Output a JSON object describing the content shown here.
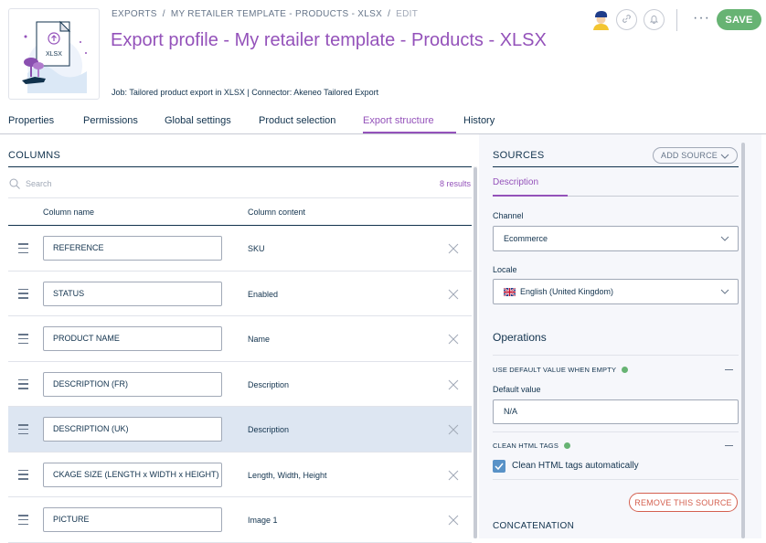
{
  "breadcrumb": {
    "items": [
      "EXPORTS",
      "MY RETAILER TEMPLATE - PRODUCTS - XLSX",
      "EDIT"
    ],
    "separator": "/"
  },
  "thumbnail": {
    "file_label": "XLSX"
  },
  "page_title": "Export profile - My retailer template - Products - XLSX",
  "job_info": "Job: Tailored product export in XLSX | Connector: Akeneo Tailored Export",
  "header_actions": {
    "more_label": "···",
    "save_label": "SAVE"
  },
  "tabs": [
    {
      "label": "Properties",
      "active": false
    },
    {
      "label": "Permissions",
      "active": false
    },
    {
      "label": "Global settings",
      "active": false
    },
    {
      "label": "Product selection",
      "active": false
    },
    {
      "label": "Export structure",
      "active": true
    },
    {
      "label": "History",
      "active": false
    }
  ],
  "columns_panel": {
    "title": "COLUMNS",
    "search_placeholder": "Search",
    "results": "8 results",
    "headers": {
      "name": "Column name",
      "content": "Column content"
    },
    "rows": [
      {
        "name": "REFERENCE",
        "content": "SKU",
        "selected": false
      },
      {
        "name": "STATUS",
        "content": "Enabled",
        "selected": false
      },
      {
        "name": "PRODUCT NAME",
        "content": "Name",
        "selected": false
      },
      {
        "name": "DESCRIPTION (FR)",
        "content": "Description",
        "selected": false
      },
      {
        "name": "DESCRIPTION (UK)",
        "content": "Description",
        "selected": true
      },
      {
        "name": "CKAGE SIZE (LENGTH x WIDTH x HEIGHT)",
        "content": "Length, Width, Height",
        "selected": false
      },
      {
        "name": "PICTURE",
        "content": "Image 1",
        "selected": false
      }
    ]
  },
  "sources_panel": {
    "title": "SOURCES",
    "add_source_label": "ADD SOURCE",
    "source_tab": "Description",
    "channel": {
      "label": "Channel",
      "value": "Ecommerce"
    },
    "locale": {
      "label": "Locale",
      "value": "English (United Kingdom)"
    },
    "operations_title": "Operations",
    "default_value_op": {
      "title": "USE DEFAULT VALUE WHEN EMPTY",
      "field_label": "Default value",
      "field_value": "N/A"
    },
    "clean_html_op": {
      "title": "CLEAN HTML TAGS",
      "checkbox_label": "Clean HTML tags automatically",
      "checked": true
    },
    "remove_label": "REMOVE THIS SOURCE",
    "concatenation_title": "CONCATENATION"
  },
  "colors": {
    "accent": "#9452ba",
    "save": "#67b373",
    "status_dot": "#67b373",
    "danger": "#d4604f",
    "checkbox": "#5992c7"
  }
}
